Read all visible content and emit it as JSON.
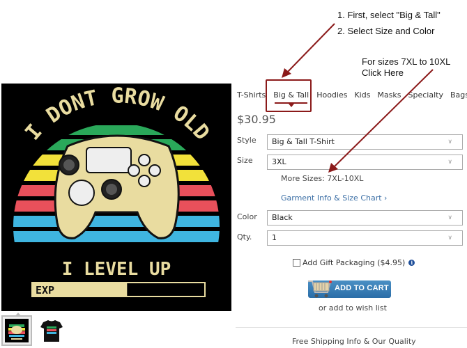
{
  "annotations": {
    "step1": "1. First, select \"Big & Tall\"",
    "step2": "2. Select Size and Color",
    "more_sizes_note_line1": "For sizes 7XL to 10XL",
    "more_sizes_note_line2": "Click Here",
    "arrow_color": "#8b1a1a"
  },
  "product_image": {
    "title_top": "I DONT GROW OLD",
    "title_bottom": "I LEVEL UP",
    "bar_label": "EXP",
    "exp_fill_fraction": 0.55,
    "stripe_colors": [
      "#2aa85a",
      "#f2e13a",
      "#e8505b",
      "#3fb5e0"
    ],
    "art_color": "#e9dca0"
  },
  "thumbnails": [
    {
      "name": "design-art",
      "active": true
    },
    {
      "name": "shirt-preview",
      "active": false
    }
  ],
  "tabs": [
    {
      "label": "T-Shirts"
    },
    {
      "label": "Big & Tall",
      "selected": true
    },
    {
      "label": "Hoodies"
    },
    {
      "label": "Kids"
    },
    {
      "label": "Masks"
    },
    {
      "label": "Specialty"
    },
    {
      "label": "Bags"
    }
  ],
  "price": "$30.95",
  "form": {
    "style_label": "Style",
    "style_value": "Big & Tall T-Shirt",
    "size_label": "Size",
    "size_value": "3XL",
    "more_sizes": "More Sizes: 7XL-10XL",
    "garment_link": "Garment Info & Size Chart ›",
    "color_label": "Color",
    "color_value": "Black",
    "qty_label": "Qty.",
    "qty_value": "1",
    "chevron": "∨",
    "gift_label": "Add Gift Packaging ($4.95)",
    "gift_checked": false,
    "info_icon": "i"
  },
  "actions": {
    "add_to_cart": "ADD TO CART",
    "wishlist": "or add to wish list",
    "shipping_info": "Free Shipping Info & Our Quality"
  }
}
